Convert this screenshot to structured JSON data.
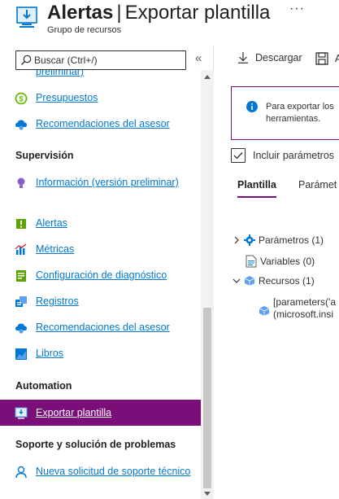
{
  "header": {
    "title_name": "Alertas",
    "title_separator": "|",
    "title_page": "Exportar plantilla",
    "subtitle": "Grupo de recursos",
    "more_label": "···"
  },
  "search": {
    "placeholder": "Buscar (Ctrl+/)",
    "collapse_label": "«"
  },
  "nav": {
    "partial_top_label": "preliminar)",
    "items_top": [
      {
        "label": "Presupuestos",
        "icon": "budget-icon"
      },
      {
        "label": "Recomendaciones del asesor",
        "icon": "advisor-icon"
      }
    ],
    "section_supervision": "Supervisión",
    "items_supervision": [
      {
        "label": "Información (versión preliminar)",
        "icon": "insights-icon"
      },
      {
        "label": "Alertas",
        "icon": "alerts-icon"
      },
      {
        "label": "Métricas",
        "icon": "metrics-icon"
      },
      {
        "label": "Configuración de diagnóstico",
        "icon": "diagnostic-settings-icon"
      },
      {
        "label": "Registros",
        "icon": "logs-icon"
      },
      {
        "label": "Recomendaciones del asesor",
        "icon": "advisor-icon"
      },
      {
        "label": "Libros",
        "icon": "workbooks-icon"
      }
    ],
    "section_automation": "Automation",
    "items_automation": [
      {
        "label": "Exportar plantilla",
        "icon": "export-template-icon",
        "active": true
      }
    ],
    "section_support": "Soporte y solución de problemas",
    "items_support": [
      {
        "label": "Nueva solicitud de soporte técnico",
        "icon": "support-icon"
      }
    ]
  },
  "toolbar": {
    "download_label": "Descargar",
    "add_label": "A"
  },
  "info": {
    "text": "Para exportar los herramientas."
  },
  "checkbox": {
    "label": "Incluir parámetros",
    "checked": true
  },
  "tabs": [
    {
      "label": "Plantilla",
      "active": true
    },
    {
      "label": "Parámet",
      "active": false
    }
  ],
  "tree": {
    "parameters": "Parámetros (1)",
    "variables": "Variables (0)",
    "resources": "Recursos (1)",
    "resource_line1": "[parameters('a",
    "resource_line2": "(microsoft.insi"
  },
  "colors": {
    "accent": "#7a0f7a",
    "link": "#0078d4"
  }
}
